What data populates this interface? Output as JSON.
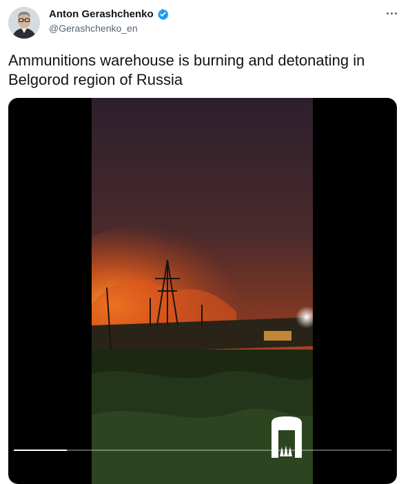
{
  "author": {
    "display_name": "Anton Gerashchenko",
    "handle": "@Gerashchenko_en",
    "verified": true
  },
  "tweet": {
    "text": "Ammunitions warehouse is burning and detonating in Belgorod region of Russia"
  },
  "video": {
    "progress_fraction": 0.14
  },
  "icons": {
    "verified": "verified-badge-icon",
    "more": "more-options-icon"
  },
  "colors": {
    "verified_blue": "#1d9bf0",
    "text_primary": "#0f1419",
    "text_secondary": "#536471"
  }
}
